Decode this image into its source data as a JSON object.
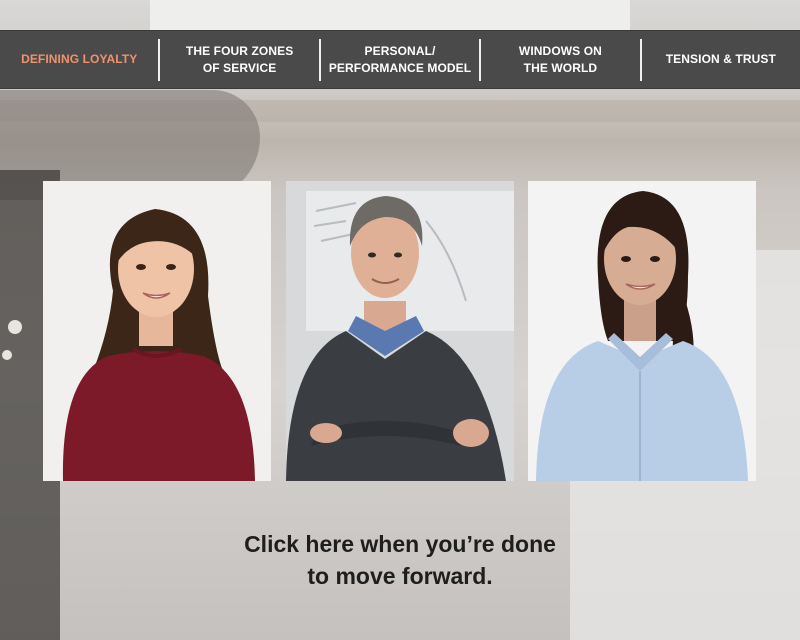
{
  "nav": {
    "items": [
      {
        "label": "DEFINING LOYALTY",
        "active": true
      },
      {
        "label": "THE FOUR ZONES\nOF SERVICE",
        "active": false
      },
      {
        "label": "PERSONAL/\nPERFORMANCE MODEL",
        "active": false
      },
      {
        "label": "WINDOWS ON\nTHE WORLD",
        "active": false
      },
      {
        "label": "TENSION & TRUST",
        "active": false
      }
    ],
    "active_color": "#f0926c",
    "bar_color": "#4a4a4a"
  },
  "people": [
    {
      "name": "person-woman-red-sweater",
      "shirt_color": "#7d1a2a"
    },
    {
      "name": "person-man-grey-sweater",
      "shirt_color": "#3a3d42"
    },
    {
      "name": "person-woman-blue-shirt",
      "shirt_color": "#b8cde6"
    }
  ],
  "cta": {
    "line1": "Click here when you’re done",
    "line2": "to move forward."
  }
}
